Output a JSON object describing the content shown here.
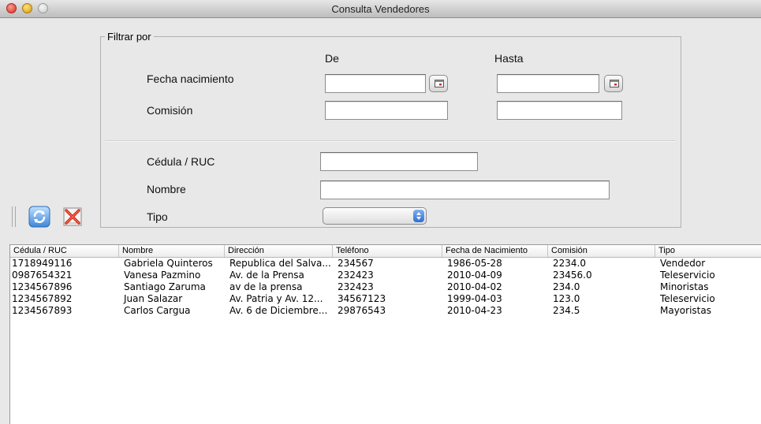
{
  "window": {
    "title": "Consulta Vendedores"
  },
  "filter": {
    "legend": "Filtrar por",
    "col_from": "De",
    "col_to": "Hasta",
    "birth_label": "Fecha nacimiento",
    "commission_label": "Comisión",
    "ruc_label": "Cédula / RUC",
    "name_label": "Nombre",
    "type_label": "Tipo",
    "birth_from": "",
    "birth_to": "",
    "commission_from": "",
    "commission_to": "",
    "ruc": "",
    "name": "",
    "type_selected": ""
  },
  "toolbar": {
    "refresh_icon": "refresh-icon",
    "clear_icon": "clear-icon"
  },
  "table": {
    "columns": [
      "Cédula / RUC",
      "Nombre",
      "Dirección",
      "Teléfono",
      "Fecha de Nacimiento",
      "Comisión",
      "Tipo"
    ],
    "rows": [
      [
        "1718949116",
        "Gabriela Quinteros",
        "Republica del Salva...",
        "234567",
        "1986-05-28",
        "2234.0",
        "Vendedor"
      ],
      [
        "0987654321",
        "Vanesa Pazmino",
        "Av. de la Prensa",
        "232423",
        "2010-04-09",
        "23456.0",
        "Teleservicio"
      ],
      [
        "1234567896",
        "Santiago Zaruma",
        "av de la prensa",
        "232423",
        "2010-04-02",
        "234.0",
        "Minoristas"
      ],
      [
        "1234567892",
        "Juan Salazar",
        "Av. Patria y Av. 12...",
        "34567123",
        "1999-04-03",
        "123.0",
        "Teleservicio"
      ],
      [
        "1234567893",
        "Carlos Cargua",
        "Av. 6 de Diciembre...",
        "29876543",
        "2010-04-23",
        "234.5",
        "Mayoristas"
      ]
    ]
  }
}
